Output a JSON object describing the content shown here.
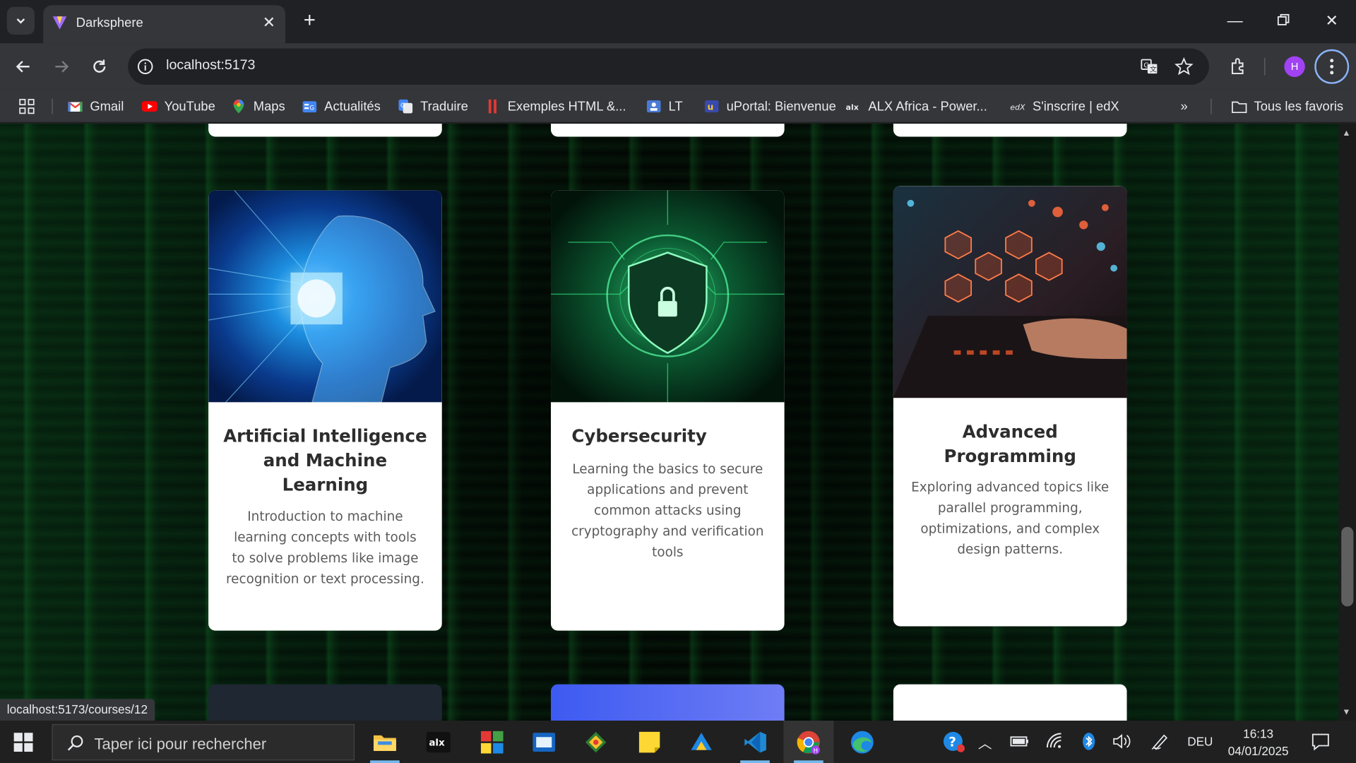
{
  "browser": {
    "tab": {
      "title": "Darksphere"
    },
    "address": {
      "url": "localhost:5173"
    },
    "profile_initial": "H",
    "bookmarks": [
      {
        "label": "Gmail",
        "icon": "gmail-icon"
      },
      {
        "label": "YouTube",
        "icon": "youtube-icon"
      },
      {
        "label": "Maps",
        "icon": "maps-icon"
      },
      {
        "label": "Actualités",
        "icon": "news-icon"
      },
      {
        "label": "Traduire",
        "icon": "translate-icon"
      },
      {
        "label": "Exemples HTML &...",
        "icon": "bookmark-icon"
      },
      {
        "label": "LT",
        "icon": "bookmark-icon"
      },
      {
        "label": "uPortal: Bienvenue",
        "icon": "bookmark-icon"
      },
      {
        "label": "ALX Africa - Power...",
        "icon": "alx-icon"
      },
      {
        "label": "S'inscrire | edX",
        "icon": "edx-icon"
      }
    ],
    "all_bookmarks_label": "Tous les favoris",
    "status_url": "localhost:5173/courses/12"
  },
  "courses": [
    {
      "title": "Artificial Intelligence and Machine Learning",
      "description": "Introduction to machine learning concepts with tools to solve problems like image recognition or text processing."
    },
    {
      "title": "Cybersecurity",
      "description": "Learning the basics to secure applications and prevent common attacks using cryptography and verification tools"
    },
    {
      "title": "Advanced Programming",
      "description": "Exploring advanced topics like parallel programming, optimizations, and complex design patterns."
    }
  ],
  "taskbar": {
    "search_placeholder": "Taper ici pour rechercher",
    "language": "DEU",
    "time": "16:13",
    "date": "04/01/2025"
  },
  "colors": {
    "card_bg": "#ffffff",
    "accent": "#8ab4f8",
    "matrix_green": "#1e8c3c"
  }
}
